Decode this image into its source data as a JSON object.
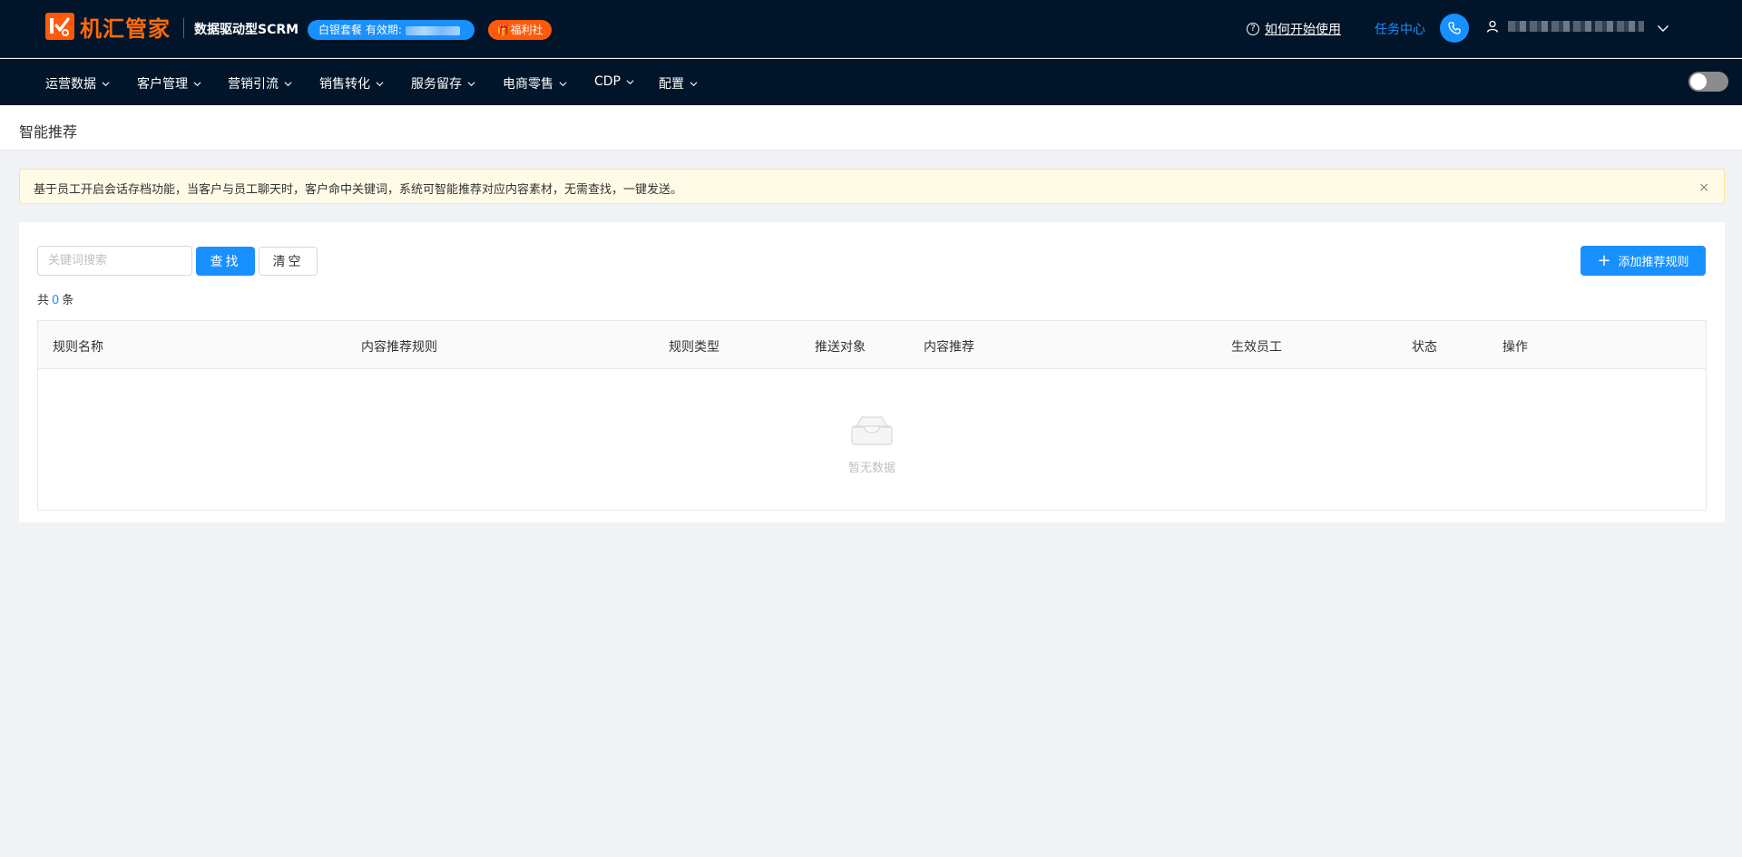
{
  "header": {
    "logo_text": "机汇管家",
    "product_name": "数据驱动型SCRM",
    "package_label": "白银套餐 有效期:",
    "welfare_label": "🎁福利社",
    "help_label": "如何开始使用",
    "task_center_label": "任务中心"
  },
  "nav": {
    "items": [
      {
        "label": "运营数据"
      },
      {
        "label": "客户管理"
      },
      {
        "label": "营销引流"
      },
      {
        "label": "销售转化"
      },
      {
        "label": "服务留存"
      },
      {
        "label": "电商零售"
      },
      {
        "label": "CDP"
      },
      {
        "label": "配置"
      }
    ]
  },
  "page": {
    "title": "智能推荐"
  },
  "alert": {
    "text": "基于员工开启会话存档功能，当客户与员工聊天时，客户命中关键词，系统可智能推荐对应内容素材，无需查找，一键发送。",
    "close": "×"
  },
  "toolbar": {
    "search_placeholder": "关键词搜索",
    "search_label": "查找",
    "clear_label": "清空",
    "add_label": "添加推荐规则",
    "total_prefix": "共",
    "total_count": "0",
    "total_suffix": "条"
  },
  "table": {
    "columns": [
      "规则名称",
      "内容推荐规则",
      "规则类型",
      "推送对象",
      "内容推荐",
      "生效员工",
      "状态",
      "操作"
    ],
    "rows": [],
    "empty_text": "暂无数据"
  },
  "colors": {
    "header_bg": "#001529",
    "brand_orange": "#ff5a0a",
    "primary": "#1890ff",
    "alert_bg": "#fffbe6"
  },
  "icons": [
    "logo-mark-icon",
    "question-circle-icon",
    "phone-icon",
    "user-icon",
    "chevron-down-icon",
    "close-icon",
    "plus-icon",
    "inbox-empty-icon"
  ]
}
